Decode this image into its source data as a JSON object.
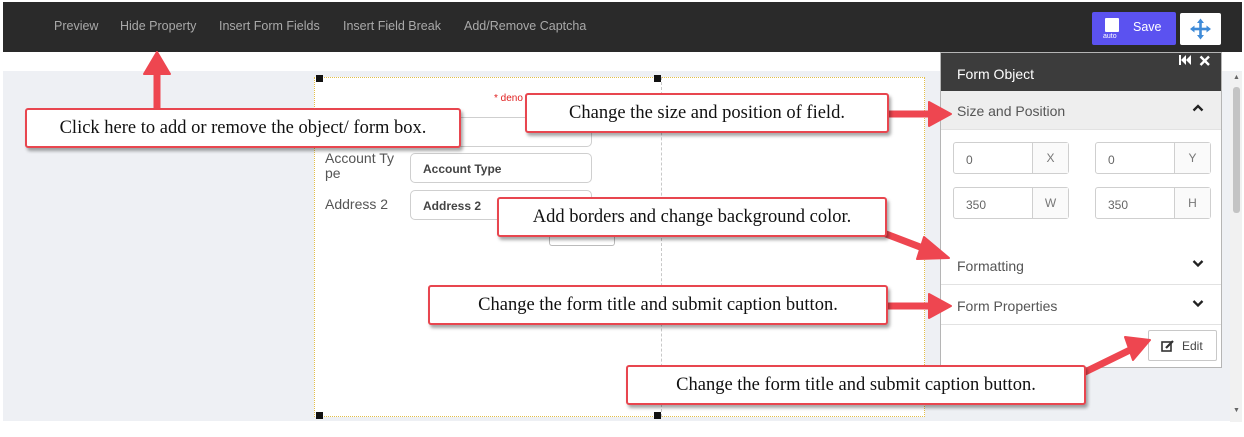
{
  "toolbar": {
    "nav": [
      "Preview",
      "Hide Property",
      "Insert Form Fields",
      "Insert Field Break",
      "Add/Remove Captcha"
    ],
    "save_label": "Save",
    "save_sub": "auto"
  },
  "form": {
    "required_note": "* deno",
    "fields": [
      {
        "label_line1": "Account Ty",
        "label_line2": "pe",
        "placeholder": "Account Type"
      },
      {
        "label": "Address 2",
        "placeholder": "Address 2"
      }
    ]
  },
  "panel": {
    "title": "Form Object",
    "sections": {
      "size_position": "Size and Position",
      "formatting": "Formatting",
      "form_properties": "Form Properties"
    },
    "x_value": "0",
    "x_unit": "X",
    "y_value": "0",
    "y_unit": "Y",
    "w_value": "350",
    "w_unit": "W",
    "h_value": "350",
    "h_unit": "H",
    "edit_label": "Edit"
  },
  "callouts": {
    "object_box": "Click here to add or remove the object/ form box.",
    "size_position": "Change the size and position of field.",
    "borders": "Add borders and change background color.",
    "form_title": "Change the form title and submit caption button.",
    "edit": "Change the form title and submit caption button."
  },
  "colors": {
    "toolbar_bg": "#2a2a2a",
    "save_button": "#5b52f0",
    "callout_border": "#e8464f",
    "arrow": "#ee4650",
    "required": "#e02020"
  }
}
